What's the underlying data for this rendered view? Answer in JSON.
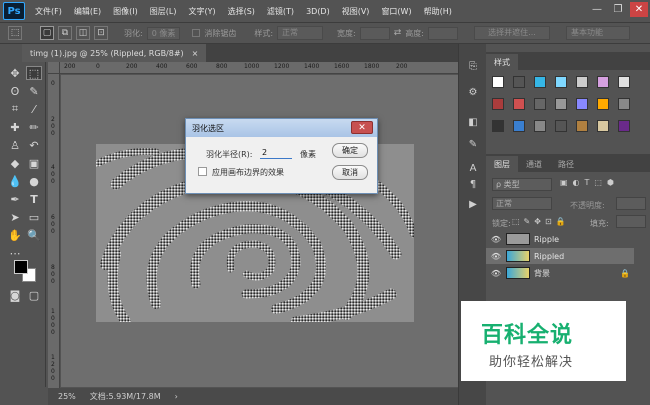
{
  "app": {
    "logo": "Ps",
    "menus": [
      "文件(F)",
      "编辑(E)",
      "图像(I)",
      "图层(L)",
      "文字(Y)",
      "选择(S)",
      "滤镜(T)",
      "3D(D)",
      "视图(V)",
      "窗口(W)",
      "帮助(H)"
    ],
    "window_controls": {
      "minimize": "—",
      "restore": "❐",
      "close": "✕"
    }
  },
  "options_bar": {
    "feather_label": "羽化:",
    "feather_value": "0 像素",
    "antialias_label": "消除锯齿",
    "style_label": "样式:",
    "style_value": "正常",
    "width_label": "宽度:",
    "height_label": "高度:",
    "select_mask_button": "选择并遮住...",
    "workspace_select": "基本功能"
  },
  "document": {
    "tab_title": "timg (1).jpg @ 25% (Rippled, RGB/8#)",
    "tab_close": "×",
    "ruler_h": [
      "200",
      "0",
      "200",
      "400",
      "600",
      "800",
      "1000",
      "1200",
      "1400",
      "1600",
      "1800",
      "200"
    ],
    "ruler_v": [
      "0",
      "2",
      "0",
      "0",
      "4",
      "0",
      "0",
      "6",
      "0",
      "0",
      "8",
      "0",
      "0",
      "1",
      "0",
      "0",
      "0",
      "1",
      "2",
      "0",
      "0"
    ]
  },
  "status": {
    "zoom": "25%",
    "doc_info": "文档:5.93M/17.8M",
    "arrow": "›"
  },
  "styles_panel": {
    "tab": "样式",
    "swatch_colors": [
      "#ffffff",
      "#555555",
      "#35b6e6",
      "#7fd8ff",
      "#cccccc",
      "#d6a0e0",
      "#e0e0e0",
      "#aa3c3c",
      "#d05050",
      "#666666",
      "#999999",
      "#8888ff",
      "#ffaa00",
      "#888888",
      "#333333",
      "#3a7fd0",
      "#888888",
      "#555555",
      "#b08040",
      "#d8c8a0",
      "#6a2a8a"
    ]
  },
  "layers_panel": {
    "tabs": [
      "图层",
      "通道",
      "路径"
    ],
    "filter_kind": "ρ 类型",
    "blend_mode": "正常",
    "opacity_label": "不透明度:",
    "lock_label": "锁定:",
    "fill_label": "填充:",
    "layers": [
      {
        "name": "Ripple",
        "selected": false,
        "locked": false
      },
      {
        "name": "Rippled",
        "selected": true,
        "locked": false
      },
      {
        "name": "背景",
        "selected": false,
        "locked": true
      }
    ],
    "footer_icons": [
      "link",
      "fx",
      "mask",
      "adjust",
      "group",
      "new",
      "trash"
    ]
  },
  "dialog": {
    "title": "羽化选区",
    "radius_label": "羽化半径(R):",
    "radius_value": "2",
    "unit": "像素",
    "checkbox_label": "应用画布边界的效果",
    "ok_button": "确定",
    "cancel_button": "取消"
  },
  "watermark": {
    "title": "百科全说",
    "subtitle": "助你轻松解决"
  }
}
